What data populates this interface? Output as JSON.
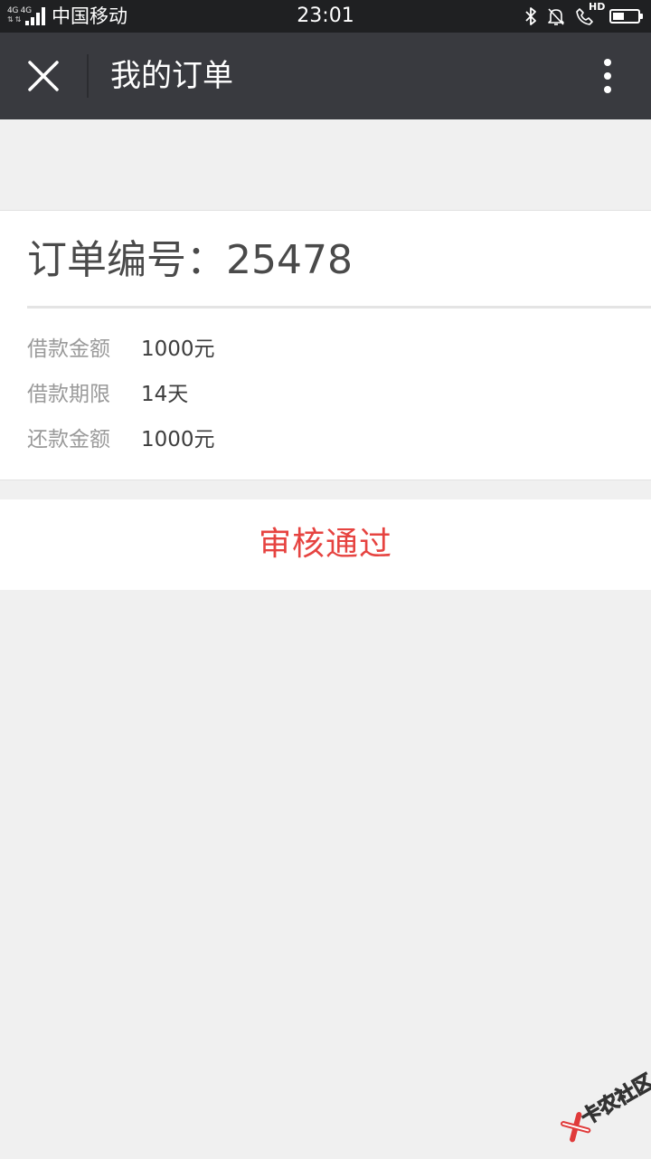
{
  "status_bar": {
    "network": "4G 4G",
    "carrier": "中国移动",
    "time": "23:01",
    "call_badge": "HD",
    "battery_level": 0.45
  },
  "top_bar": {
    "title": "我的订单",
    "close_icon": "close-icon",
    "more_icon": "more-vertical-icon"
  },
  "order": {
    "number_label": "订单编号：",
    "number": "25478",
    "details": [
      {
        "label": "借款金额",
        "value": "1000元"
      },
      {
        "label": "借款期限",
        "value": "14天"
      },
      {
        "label": "还款金额",
        "value": "1000元"
      }
    ]
  },
  "status_button": {
    "label": "审核通过",
    "color": "#e64340"
  },
  "watermark": {
    "text": "卡农社区"
  },
  "colors": {
    "top_bar": "#393a3f",
    "status_bar": "#1f2022",
    "background": "#f0f0f0",
    "accent_red": "#e64340"
  }
}
